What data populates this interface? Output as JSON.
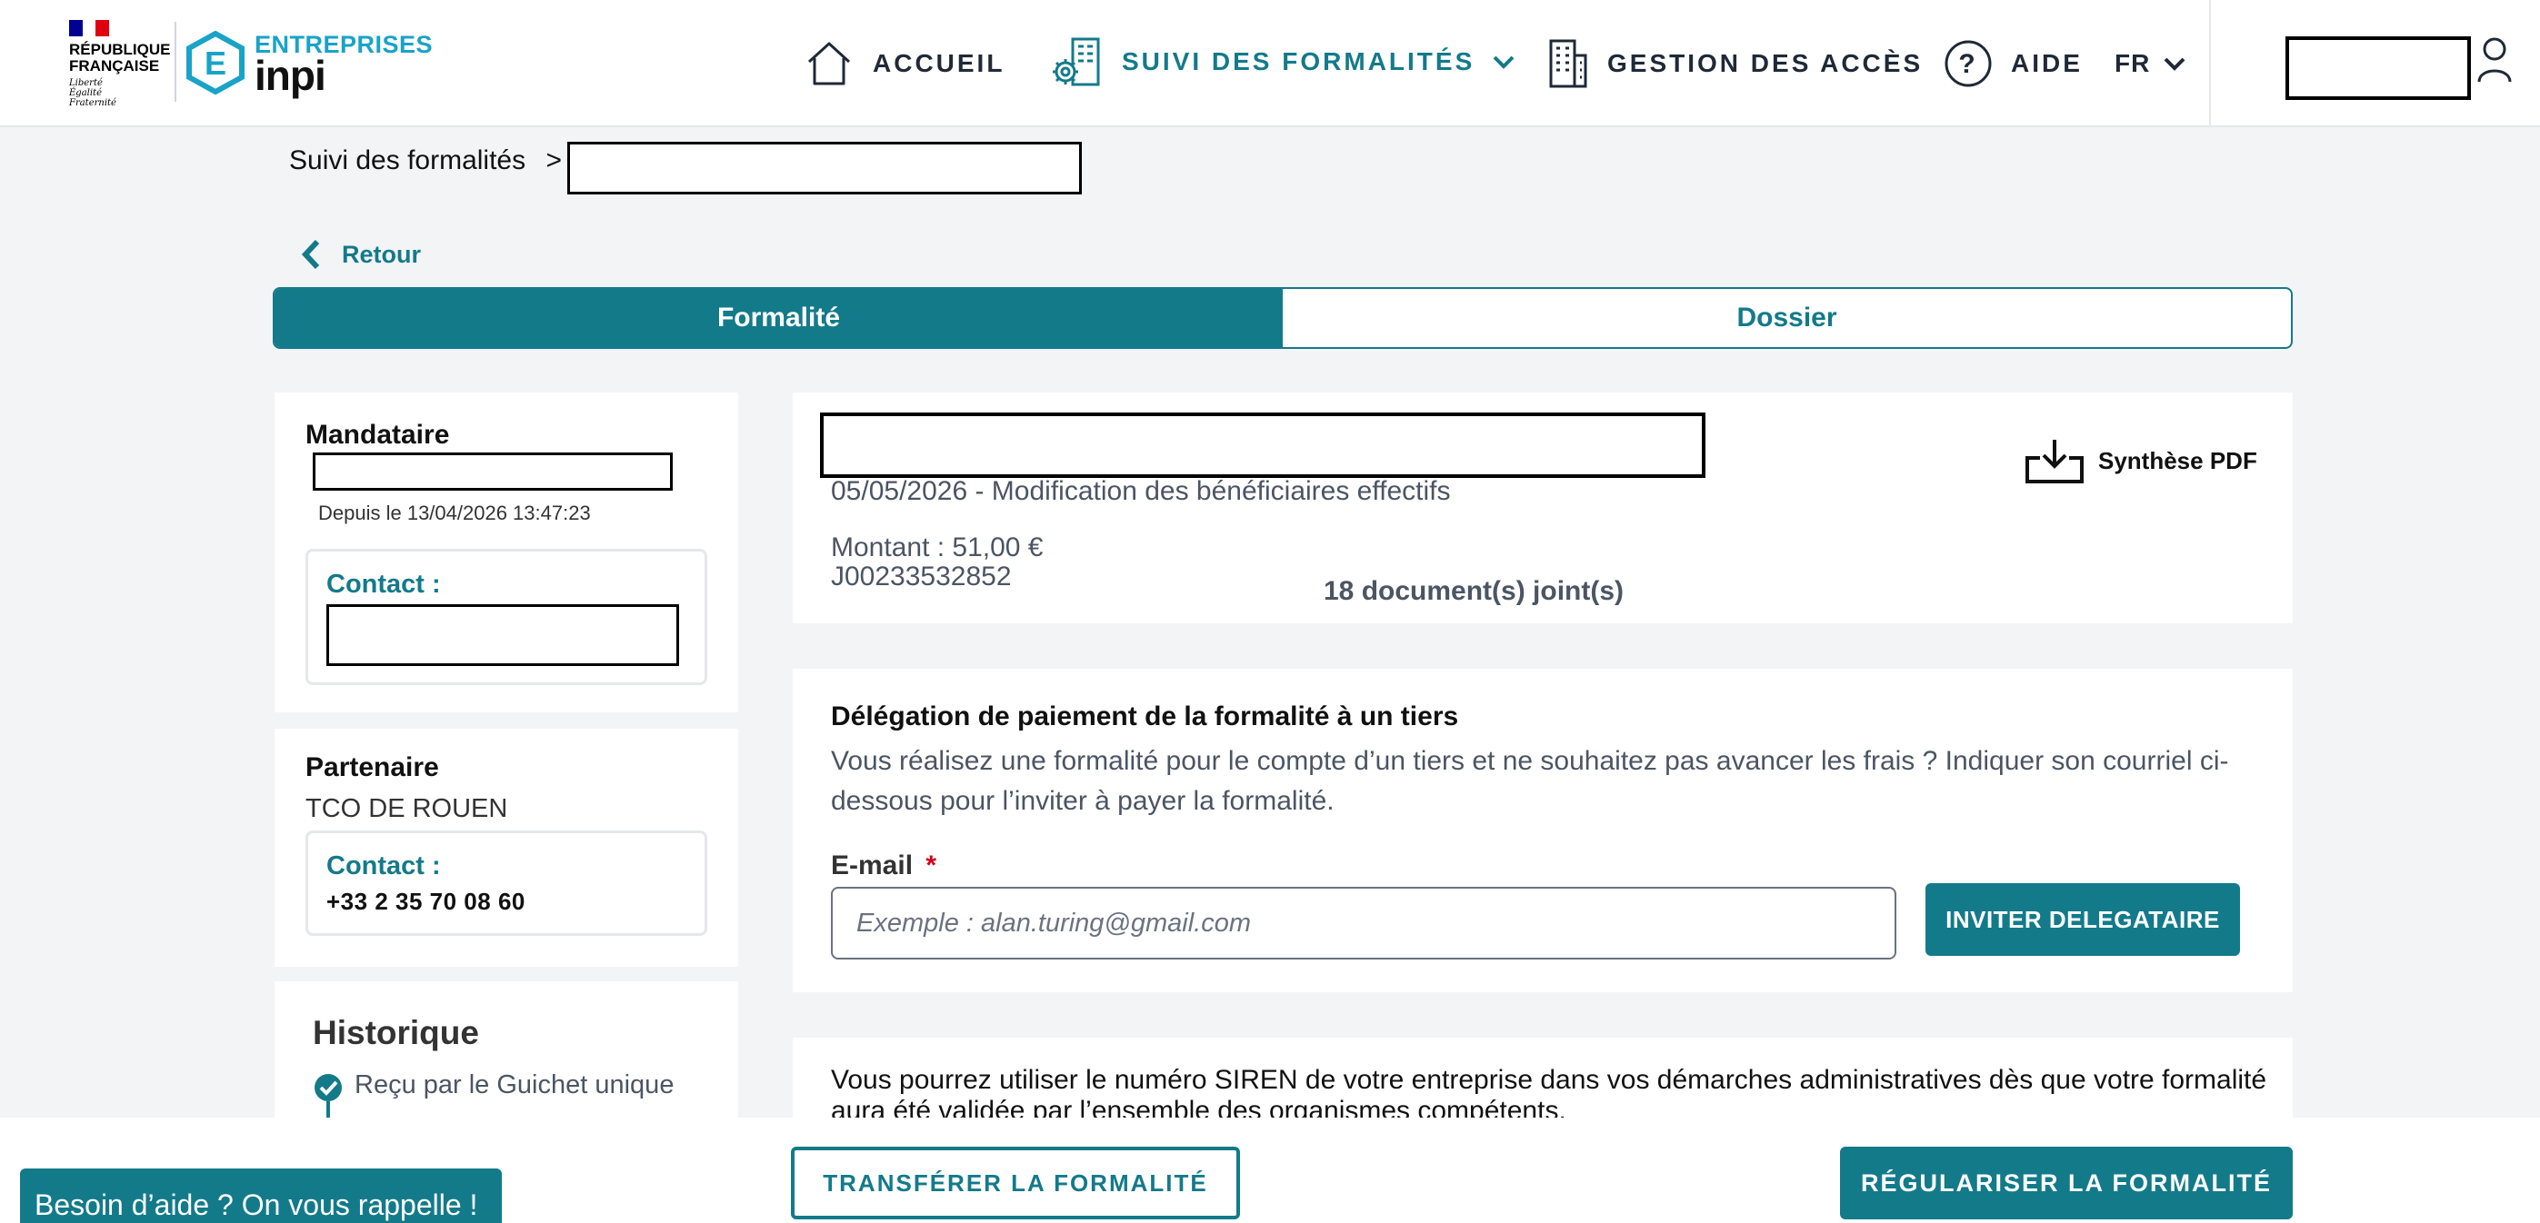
{
  "header": {
    "rf_logo_lines": [
      "RÉPUBLIQUE",
      "FRANÇAISE"
    ],
    "rf_motto_lines": [
      "Liberté",
      "Égalité",
      "Fraternité"
    ],
    "brand_top": "ENTREPRISES",
    "brand_bottom": "inpi",
    "brand_hex_letter": "E",
    "nav": {
      "home": "ACCUEIL",
      "tracking": "SUIVI DES FORMALITÉS",
      "access": "GESTION DES ACCÈS",
      "help": "AIDE",
      "lang": "FR"
    },
    "icons": [
      "home-icon",
      "gear-building-icon",
      "chevron-down-icon",
      "building-document-icon",
      "question-circle-icon",
      "user-icon"
    ]
  },
  "breadcrumb": {
    "root": "Suivi des formalités",
    "separator": ">"
  },
  "back": {
    "label": "Retour"
  },
  "tabs": {
    "formalite": "Formalité",
    "dossier": "Dossier"
  },
  "mandataire": {
    "title": "Mandataire",
    "since": "Depuis le 13/04/2026 13:47:23",
    "contact_label": "Contact :"
  },
  "partenaire": {
    "title": "Partenaire",
    "name": "TCO DE ROUEN",
    "contact_label": "Contact :",
    "phone": "+33 2 35 70 08 60"
  },
  "historique": {
    "title": "Historique",
    "items": [
      "Reçu par le Guichet unique"
    ]
  },
  "formality": {
    "date_type": "05/05/2026 - Modification des bénéficiaires effectifs",
    "amount": "Montant : 51,00 €",
    "reference": "J00233532852",
    "documents": "18 document(s) joint(s)",
    "pdf_label": "Synthèse PDF"
  },
  "delegation": {
    "title": "Délégation de paiement de la formalité à un tiers",
    "description": "Vous réalisez une formalité pour le compte d’un tiers et ne souhaitez pas avancer les frais ? Indiquer son courriel ci-dessous pour l’inviter à payer la formalité.",
    "email_label": "E-mail",
    "required_mark": "*",
    "email_placeholder": "Exemple : alan.turing@gmail.com",
    "invite_button": "INVITER DELEGATAIRE"
  },
  "siren_notice": "Vous pourrez utiliser le numéro SIREN de votre entreprise dans vos démarches administratives dès que votre formalité aura été validée par l’ensemble des organismes compétents.",
  "footer": {
    "help_callback": "Besoin d’aide ? On vous rappelle !",
    "transfer_button": "TRANSFÉRER LA FORMALITÉ",
    "regularise_button": "RÉGULARISER LA FORMALITÉ"
  },
  "colors": {
    "primary": "#137a8a",
    "brand_blue": "#19a3c7",
    "background": "#f3f4f6",
    "required": "#d0021b"
  }
}
